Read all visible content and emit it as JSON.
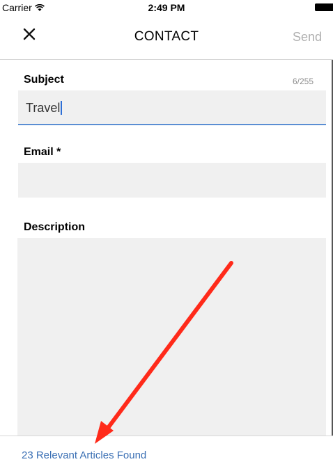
{
  "status_bar": {
    "carrier": "Carrier",
    "time": "2:49 PM"
  },
  "nav": {
    "title": "CONTACT",
    "send_label": "Send",
    "close_icon": "close-icon"
  },
  "form": {
    "subject": {
      "label": "Subject",
      "value": "Travel",
      "counter": "6/255"
    },
    "email": {
      "label": "Email *",
      "value": ""
    },
    "description": {
      "label": "Description",
      "value": ""
    }
  },
  "footer": {
    "articles_link": "23 Relevant Articles Found"
  },
  "colors": {
    "accent": "#3a6fb4",
    "focus_underline": "#5b8ed3",
    "field_bg": "#f0f0f0",
    "annotation_arrow": "#ff2a1a"
  }
}
